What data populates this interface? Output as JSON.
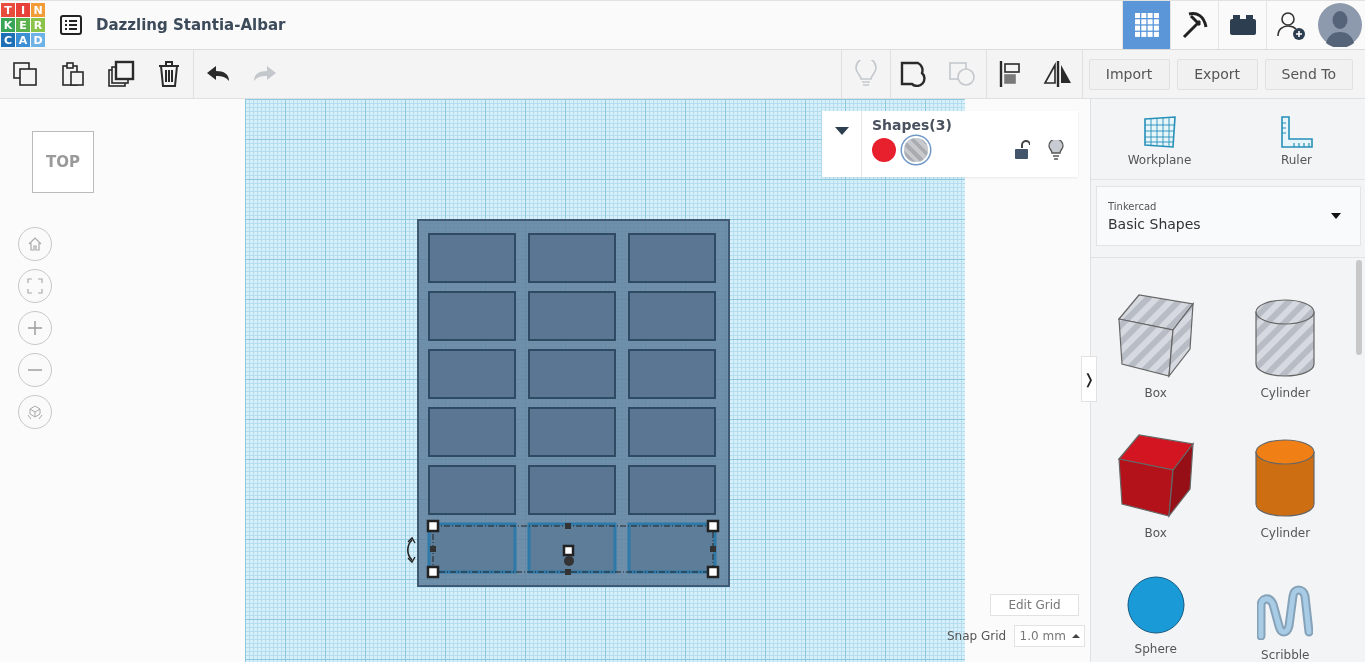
{
  "header": {
    "logo_letters": [
      {
        "text": "T",
        "color": "#e74c3c"
      },
      {
        "text": "I",
        "color": "#e8413a"
      },
      {
        "text": "N",
        "color": "#f29c38"
      },
      {
        "text": "K",
        "color": "#3aa457"
      },
      {
        "text": "E",
        "color": "#5bb14b"
      },
      {
        "text": "R",
        "color": "#8cc34a"
      },
      {
        "text": "C",
        "color": "#1e6fb5"
      },
      {
        "text": "A",
        "color": "#3c8fd3"
      },
      {
        "text": "D",
        "color": "#6fb3e6"
      }
    ],
    "project_title": "Dazzling Stantia-Albar",
    "mode_tools": [
      {
        "kind": "grid",
        "selected": true
      },
      {
        "kind": "pickaxe",
        "selected": false
      },
      {
        "kind": "bricks",
        "selected": false
      },
      {
        "kind": "invite",
        "selected": false
      }
    ]
  },
  "toolbar": {
    "edit_tools": [
      {
        "kind": "copy",
        "disabled": false
      },
      {
        "kind": "paste",
        "disabled": false
      },
      {
        "kind": "duplicate",
        "disabled": false
      },
      {
        "kind": "delete",
        "disabled": false
      },
      {
        "kind": "undo",
        "disabled": false
      },
      {
        "kind": "redo",
        "disabled": true
      }
    ],
    "shape_tools": [
      {
        "kind": "bulb",
        "disabled": true
      },
      {
        "kind": "group",
        "disabled": false
      },
      {
        "kind": "ungroup",
        "disabled": true
      },
      {
        "kind": "align",
        "disabled": false
      },
      {
        "kind": "mirror",
        "disabled": false
      }
    ],
    "buttons": [
      "Import",
      "Export",
      "Send To"
    ]
  },
  "view_cube": "TOP",
  "shapes_panel": {
    "title": "Shapes(3)",
    "swatches": [
      {
        "kind": "solid",
        "color": "#e8202e",
        "selected": false
      },
      {
        "kind": "hole",
        "selected": true
      }
    ],
    "locked": false
  },
  "grid": {
    "edit_button": "Edit Grid",
    "snap_label": "Snap Grid",
    "snap_value": "1.0 mm"
  },
  "panel_toggle": "❭",
  "sidebar": {
    "tools": [
      {
        "kind": "workplane",
        "label": "Workplane"
      },
      {
        "kind": "ruler",
        "label": "Ruler"
      }
    ],
    "library": {
      "source": "Tinkercad",
      "name": "Basic Shapes"
    },
    "shapes": [
      {
        "kind": "box",
        "hole": true,
        "label": "Box"
      },
      {
        "kind": "cylinder",
        "hole": true,
        "label": "Cylinder"
      },
      {
        "kind": "box",
        "hole": false,
        "color": "#c8141e",
        "label": "Box"
      },
      {
        "kind": "cylinder",
        "hole": false,
        "color": "#e57a14",
        "label": "Cylinder"
      },
      {
        "kind": "sphere",
        "hole": false,
        "color": "#1a9ad6",
        "label": "Sphere"
      },
      {
        "kind": "scribble",
        "hole": false,
        "color": "#a8cbe6",
        "label": "Scribble"
      }
    ]
  }
}
